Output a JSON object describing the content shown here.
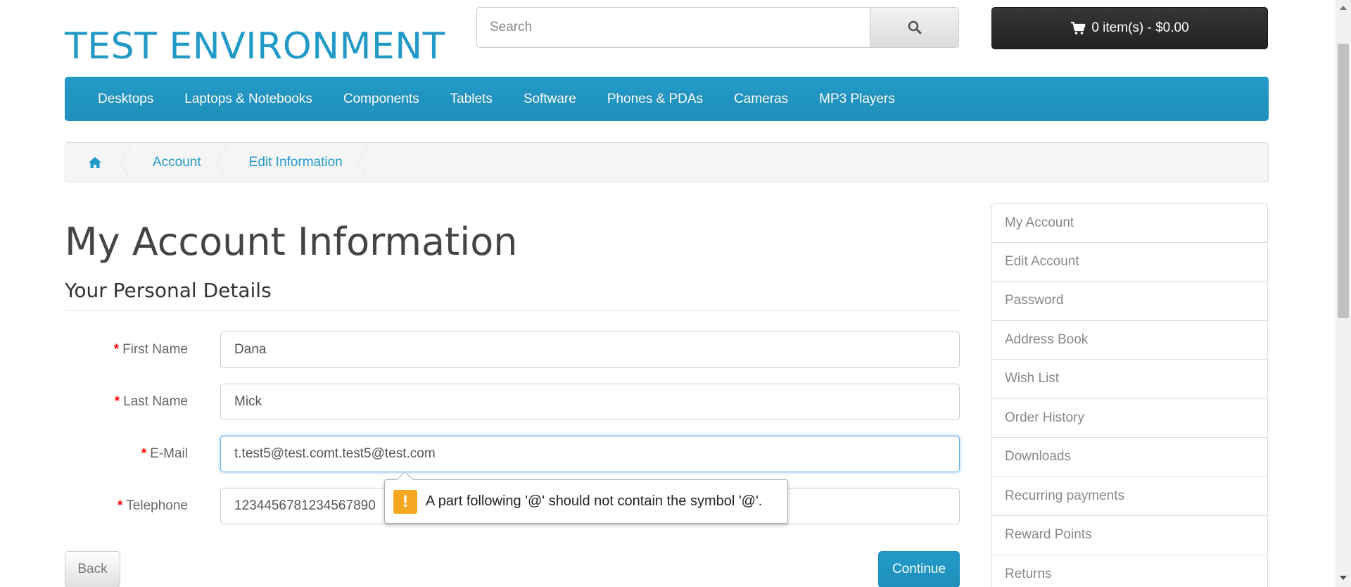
{
  "header": {
    "logo": "TEST ENVIRONMENT",
    "search_placeholder": "Search",
    "cart_label": "0 item(s) - $0.00"
  },
  "menu": [
    "Desktops",
    "Laptops & Notebooks",
    "Components",
    "Tablets",
    "Software",
    "Phones & PDAs",
    "Cameras",
    "MP3 Players"
  ],
  "breadcrumb": [
    "Account",
    "Edit Information"
  ],
  "main": {
    "title": "My Account Information",
    "legend": "Your Personal Details",
    "required_mark": "*",
    "fields": {
      "firstname": {
        "label": "First Name",
        "value": "Dana"
      },
      "lastname": {
        "label": "Last Name",
        "value": "Mick"
      },
      "email": {
        "label": "E-Mail",
        "value": "t.test5@test.comt.test5@test.com"
      },
      "telephone": {
        "label": "Telephone",
        "value": "1234456781234567890"
      }
    },
    "back_label": "Back",
    "continue_label": "Continue"
  },
  "tooltip": {
    "icon": "!",
    "message": "A part following '@' should not contain the symbol '@'."
  },
  "sidebar": [
    "My Account",
    "Edit Account",
    "Password",
    "Address Book",
    "Wish List",
    "Order History",
    "Downloads",
    "Recurring payments",
    "Reward Points",
    "Returns"
  ],
  "colors": {
    "brand": "#229ac8",
    "cart_bg": "#222222",
    "required": "#ff0000",
    "warning": "#f7a823"
  }
}
